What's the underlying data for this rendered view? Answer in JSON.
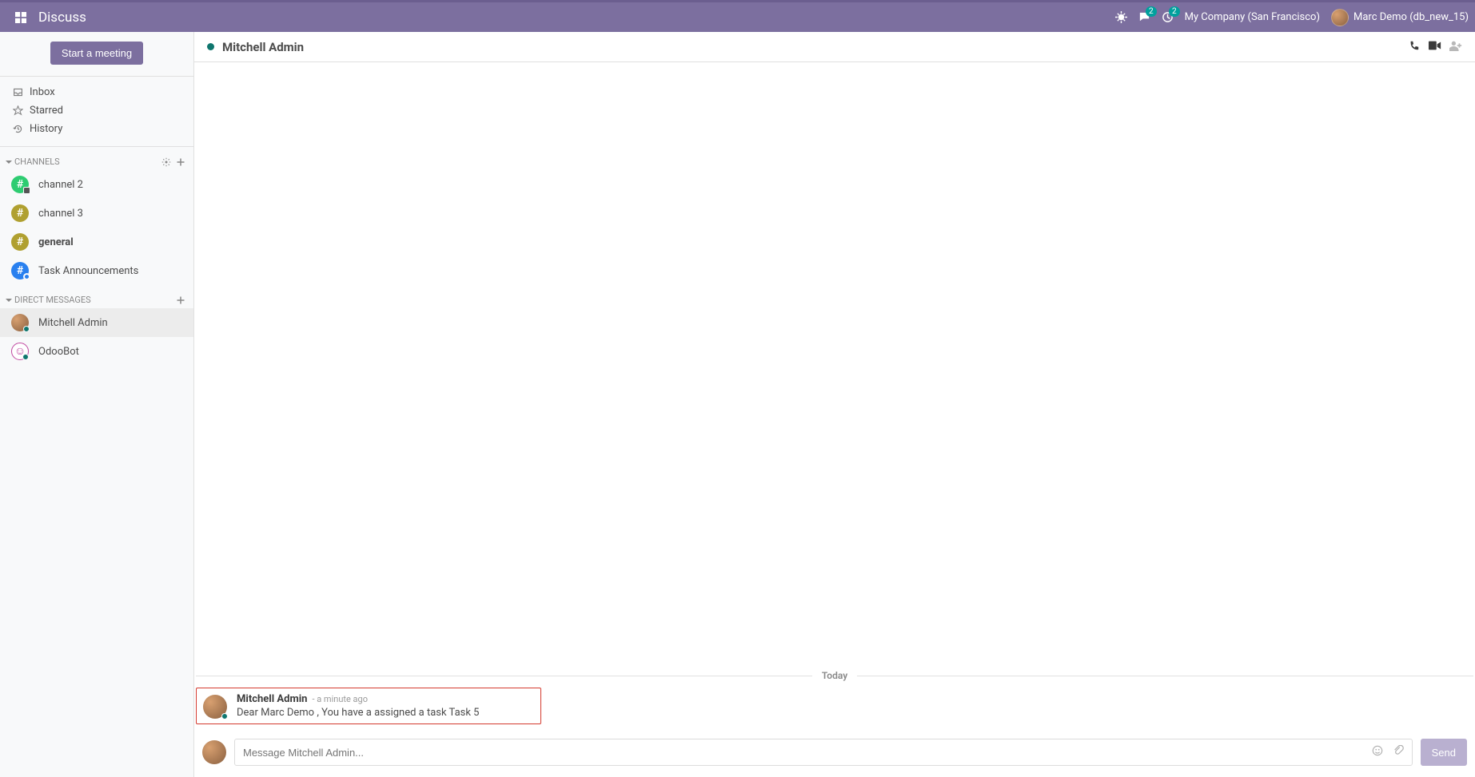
{
  "header": {
    "app_title": "Discuss",
    "chat_badge": "2",
    "activity_badge": "2",
    "company": "My Company (San Francisco)",
    "user_name": "Marc Demo (db_new_15)"
  },
  "sidebar": {
    "meeting_button": "Start a meeting",
    "nav": {
      "inbox": "Inbox",
      "starred": "Starred",
      "history": "History"
    },
    "channels_label": "Channels",
    "channels": [
      {
        "label": "channel 2"
      },
      {
        "label": "channel 3"
      },
      {
        "label": "general"
      },
      {
        "label": "Task Announcements"
      }
    ],
    "dm_label": "Direct Messages",
    "dms": [
      {
        "label": "Mitchell Admin"
      },
      {
        "label": "OdooBot"
      }
    ]
  },
  "thread": {
    "title": "Mitchell Admin",
    "separator": "Today",
    "message": {
      "author": "Mitchell Admin",
      "time": "- a minute ago",
      "body": "Dear Marc Demo , You have a assigned a task Task 5"
    },
    "composer_placeholder": "Message Mitchell Admin...",
    "send": "Send"
  }
}
